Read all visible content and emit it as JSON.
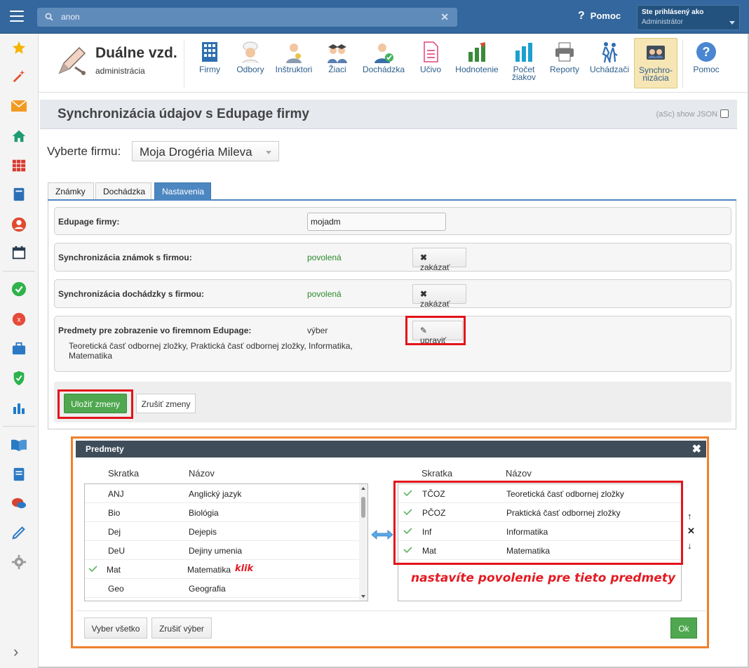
{
  "topbar": {
    "search_value": "anon",
    "help_label": "Pomoc",
    "user_line1": "Ste prihlásený ako",
    "user_line2": "Administrátor"
  },
  "sidebar": {
    "icons": [
      "star-icon",
      "magic-wand-icon",
      "mail-icon",
      "home-icon",
      "timetable-icon",
      "notebook-icon",
      "person-icon",
      "calendar-icon",
      "check-icon",
      "error-icon",
      "briefcase-icon",
      "shield-icon",
      "bar-chart-icon",
      "book-icon",
      "document-icon",
      "chat-icon",
      "pen-icon",
      "gear-icon"
    ]
  },
  "app": {
    "name": "Duálne vzd.",
    "subtitle": "administrácia"
  },
  "nav": [
    {
      "label": "Firmy"
    },
    {
      "label": "Odbory"
    },
    {
      "label": "Inštruktori"
    },
    {
      "label": "Žiaci"
    },
    {
      "label": "Dochádzka"
    },
    {
      "label": "Učivo"
    },
    {
      "label": "Hodnotenie"
    },
    {
      "label": "Počet žiakov"
    },
    {
      "label": "Reporty"
    },
    {
      "label": "Uchádzači"
    },
    {
      "label": "Synchro-nizácia"
    },
    {
      "label": "Pomoc"
    }
  ],
  "page": {
    "title": "Synchronizácia údajov s Edupage firmy",
    "json_toggle": "(aSc) show JSON",
    "firm_label": "Vyberte firmu:",
    "firm_value": "Moja Drogéria Mileva"
  },
  "tabs": [
    "Známky",
    "Dochádzka",
    "Nastavenia"
  ],
  "settings": {
    "edupage_label": "Edupage firmy:",
    "edupage_value": "mojadm",
    "grades_label": "Synchronizácia známok s firmou:",
    "grades_status": "povolená",
    "grades_button": "zakázať",
    "attendance_label": "Synchronizácia dochádzky s firmou:",
    "attendance_status": "povolená",
    "attendance_button": "zakázať",
    "subjects_label": "Predmety pre zobrazenie vo firemnom Edupage:",
    "subjects_value": "výber",
    "subjects_button": "upraviť",
    "subjects_list": "Teoretická časť odbornej zložky, Praktická časť odbornej zložky, Informatika, Matematika",
    "save_button": "Uložiť zmeny",
    "cancel_button": "Zrušiť zmeny"
  },
  "modal": {
    "title": "Predmety",
    "col_abbr": "Skratka",
    "col_name": "Názov",
    "left_items": [
      {
        "abbr": "ANJ",
        "name": "Anglický jazyk",
        "checked": false
      },
      {
        "abbr": "Bio",
        "name": "Biológia",
        "checked": false
      },
      {
        "abbr": "Dej",
        "name": "Dejepis",
        "checked": false
      },
      {
        "abbr": "DeU",
        "name": "Dejiny umenia",
        "checked": false
      },
      {
        "abbr": "Mat",
        "name": "Matematika",
        "checked": true
      },
      {
        "abbr": "Geo",
        "name": "Geografia",
        "checked": false
      }
    ],
    "right_items": [
      {
        "abbr": "TČOZ",
        "name": "Teoretická časť odbornej zložky"
      },
      {
        "abbr": "PČOZ",
        "name": "Praktická časť odbornej zložky"
      },
      {
        "abbr": "Inf",
        "name": "Informatika"
      },
      {
        "abbr": "Mat",
        "name": "Matematika"
      }
    ],
    "annotation_click": "klik",
    "annotation_note": "nastavíte povolenie pre tieto predmety",
    "select_all": "Vyber všetko",
    "clear_selection": "Zrušiť výber",
    "ok": "Ok"
  },
  "colors": {
    "topbar": "#33679d",
    "accent_green": "#4fa74f",
    "highlight_red": "#e3131b",
    "modal_border": "#f0812d"
  }
}
